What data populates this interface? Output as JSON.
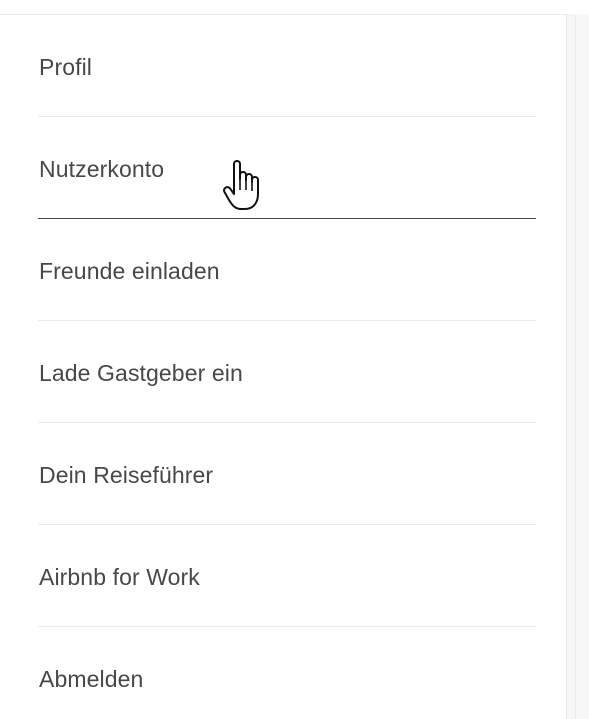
{
  "menu": {
    "items": [
      {
        "label": "Profil"
      },
      {
        "label": "Nutzerkonto",
        "hovered": true
      },
      {
        "label": "Freunde einladen"
      },
      {
        "label": "Lade Gastgeber ein"
      },
      {
        "label": "Dein Reiseführer"
      },
      {
        "label": "Airbnb for Work"
      },
      {
        "label": "Abmelden"
      }
    ]
  },
  "cursor": {
    "icon": "hand-pointer-icon",
    "over": "Nutzerkonto"
  },
  "colors": {
    "text": "#484848",
    "divider": "#ebebeb",
    "active_underline": "#484848",
    "background": "#ffffff"
  }
}
